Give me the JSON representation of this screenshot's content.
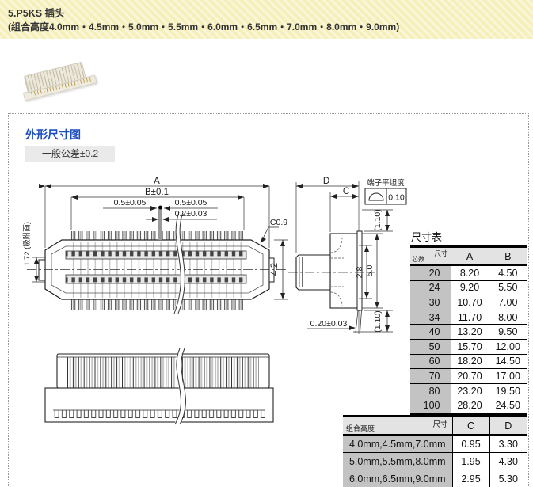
{
  "colors": {
    "header_bg": "#f6efba",
    "accent_blue": "#1d4ec0",
    "table_header_bg": "#e3e3e3",
    "table_rowlabel_bg": "#c3c3c3"
  },
  "header": {
    "title": "5.P5KS 插头",
    "subtitle": "(组合高度4.0mm・4.5mm・5.0mm・5.5mm・6.0mm・6.5mm・7.0mm・8.0mm・9.0mm)"
  },
  "section": {
    "title": "外形尺寸图",
    "tolerance": "一般公差±0.2"
  },
  "drawing": {
    "top_view": {
      "dim_a": "A",
      "dim_b": "B±0.1",
      "dim_pitch_left": "0.5±0.05",
      "dim_pitch_right": "0.5±0.05",
      "dim_pin_width": "0.2±0.03",
      "dim_suction": "1.72 (吸附面)",
      "dim_chamfer": "C0.9",
      "dim_height": "4.2"
    },
    "side_view": {
      "dim_d": "D",
      "dim_c": "C",
      "flatness_label": "端子平坦度",
      "flatness_value": "0.10",
      "dim_tail_top": "(1.10)",
      "dim_inner": "2.8",
      "dim_outer": "5.0",
      "dim_tail_bottom": "(1.10)",
      "dim_standoff": "0.20±0.03"
    }
  },
  "size_table": {
    "title": "尺寸表",
    "corner": {
      "top": "尺寸",
      "bottom": "芯数"
    },
    "columns": [
      "A",
      "B"
    ],
    "rows": [
      [
        "20",
        "8.20",
        "4.50"
      ],
      [
        "24",
        "9.20",
        "5.50"
      ],
      [
        "30",
        "10.70",
        "7.00"
      ],
      [
        "34",
        "11.70",
        "8.00"
      ],
      [
        "40",
        "13.20",
        "9.50"
      ],
      [
        "50",
        "15.70",
        "12.00"
      ],
      [
        "60",
        "18.20",
        "14.50"
      ],
      [
        "70",
        "20.70",
        "17.00"
      ],
      [
        "80",
        "23.20",
        "19.50"
      ],
      [
        "100",
        "28.20",
        "24.50"
      ]
    ]
  },
  "height_table": {
    "corner": {
      "top": "尺寸",
      "bottom": "组合高度"
    },
    "columns": [
      "C",
      "D"
    ],
    "rows": [
      [
        "4.0mm,4.5mm,7.0mm",
        "0.95",
        "3.30"
      ],
      [
        "5.0mm,5.5mm,8.0mm",
        "1.95",
        "4.30"
      ],
      [
        "6.0mm,6.5mm,9.0mm",
        "2.95",
        "5.30"
      ]
    ]
  }
}
